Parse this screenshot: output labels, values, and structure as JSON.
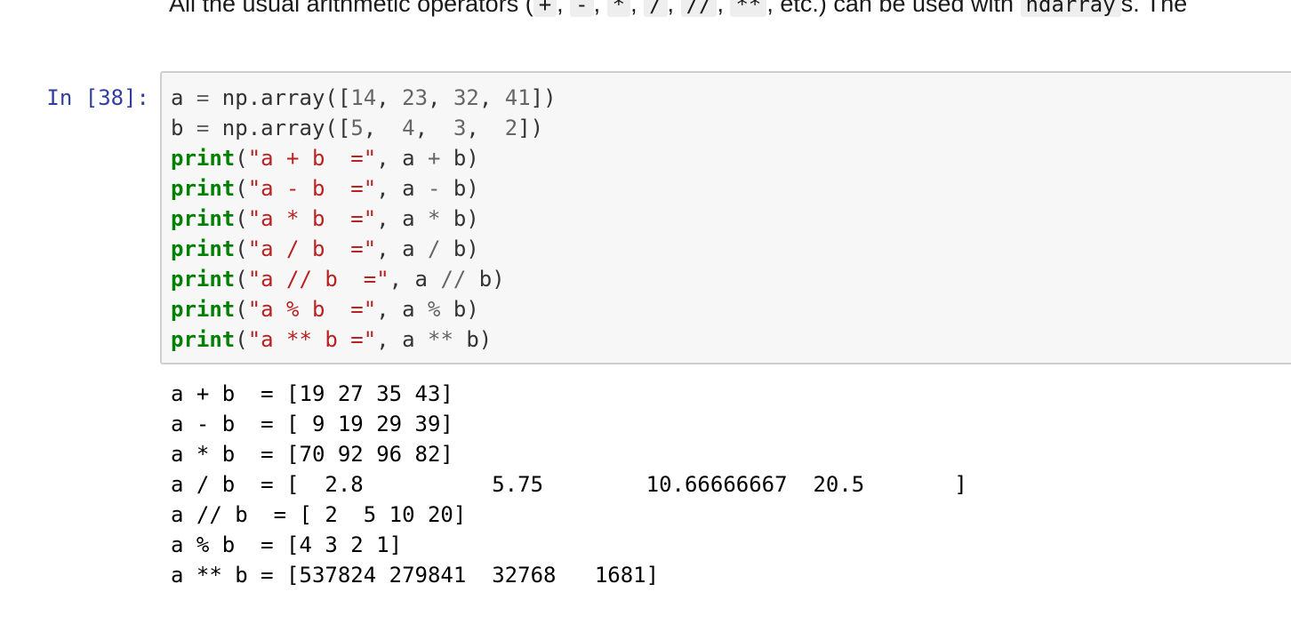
{
  "markdown": {
    "prefix": "All the usual arithmetic operators (",
    "operators": [
      "+",
      "-",
      "*",
      "/",
      "//",
      "**"
    ],
    "middle": ", etc.) can be used with ",
    "ndarray_code": "ndarray",
    "suffix": "s. The"
  },
  "cell": {
    "prompt": "In [38]:",
    "code": [
      [
        {
          "t": "a ",
          "c": ""
        },
        {
          "t": "=",
          "c": "op"
        },
        {
          "t": " np.array([",
          "c": ""
        },
        {
          "t": "14",
          "c": "num"
        },
        {
          "t": ", ",
          "c": ""
        },
        {
          "t": "23",
          "c": "num"
        },
        {
          "t": ", ",
          "c": ""
        },
        {
          "t": "32",
          "c": "num"
        },
        {
          "t": ", ",
          "c": ""
        },
        {
          "t": "41",
          "c": "num"
        },
        {
          "t": "])",
          "c": ""
        }
      ],
      [
        {
          "t": "b ",
          "c": ""
        },
        {
          "t": "=",
          "c": "op"
        },
        {
          "t": " np.array([",
          "c": ""
        },
        {
          "t": "5",
          "c": "num"
        },
        {
          "t": ",  ",
          "c": ""
        },
        {
          "t": "4",
          "c": "num"
        },
        {
          "t": ",  ",
          "c": ""
        },
        {
          "t": "3",
          "c": "num"
        },
        {
          "t": ",  ",
          "c": ""
        },
        {
          "t": "2",
          "c": "num"
        },
        {
          "t": "])",
          "c": ""
        }
      ],
      [
        {
          "t": "print",
          "c": "kw"
        },
        {
          "t": "(",
          "c": ""
        },
        {
          "t": "\"a + b  =\"",
          "c": "str"
        },
        {
          "t": ", a ",
          "c": ""
        },
        {
          "t": "+",
          "c": "op"
        },
        {
          "t": " b)",
          "c": ""
        }
      ],
      [
        {
          "t": "print",
          "c": "kw"
        },
        {
          "t": "(",
          "c": ""
        },
        {
          "t": "\"a - b  =\"",
          "c": "str"
        },
        {
          "t": ", a ",
          "c": ""
        },
        {
          "t": "-",
          "c": "op"
        },
        {
          "t": " b)",
          "c": ""
        }
      ],
      [
        {
          "t": "print",
          "c": "kw"
        },
        {
          "t": "(",
          "c": ""
        },
        {
          "t": "\"a * b  =\"",
          "c": "str"
        },
        {
          "t": ", a ",
          "c": ""
        },
        {
          "t": "*",
          "c": "op"
        },
        {
          "t": " b)",
          "c": ""
        }
      ],
      [
        {
          "t": "print",
          "c": "kw"
        },
        {
          "t": "(",
          "c": ""
        },
        {
          "t": "\"a / b  =\"",
          "c": "str"
        },
        {
          "t": ", a ",
          "c": ""
        },
        {
          "t": "/",
          "c": "op"
        },
        {
          "t": " b)",
          "c": ""
        }
      ],
      [
        {
          "t": "print",
          "c": "kw"
        },
        {
          "t": "(",
          "c": ""
        },
        {
          "t": "\"a // b  =\"",
          "c": "str"
        },
        {
          "t": ", a ",
          "c": ""
        },
        {
          "t": "//",
          "c": "op"
        },
        {
          "t": " b)",
          "c": ""
        }
      ],
      [
        {
          "t": "print",
          "c": "kw"
        },
        {
          "t": "(",
          "c": ""
        },
        {
          "t": "\"a % b  =\"",
          "c": "str"
        },
        {
          "t": ", a ",
          "c": ""
        },
        {
          "t": "%",
          "c": "op"
        },
        {
          "t": " b)",
          "c": ""
        }
      ],
      [
        {
          "t": "print",
          "c": "kw"
        },
        {
          "t": "(",
          "c": ""
        },
        {
          "t": "\"a ** b =\"",
          "c": "str"
        },
        {
          "t": ", a ",
          "c": ""
        },
        {
          "t": "**",
          "c": "op"
        },
        {
          "t": " b)",
          "c": ""
        }
      ]
    ],
    "output": [
      "a + b  = [19 27 35 43]",
      "a - b  = [ 9 19 29 39]",
      "a * b  = [70 92 96 82]",
      "a / b  = [  2.8          5.75        10.66666667  20.5       ]",
      "a // b  = [ 2  5 10 20]",
      "a % b  = [4 3 2 1]",
      "a ** b = [537824 279841  32768   1681]"
    ]
  },
  "colors": {
    "prompt": "#303f9f",
    "keyword": "#008000",
    "string": "#ba2121",
    "number": "#666666",
    "input_bg": "#f7f7f7",
    "input_border": "#cfcfcf"
  }
}
